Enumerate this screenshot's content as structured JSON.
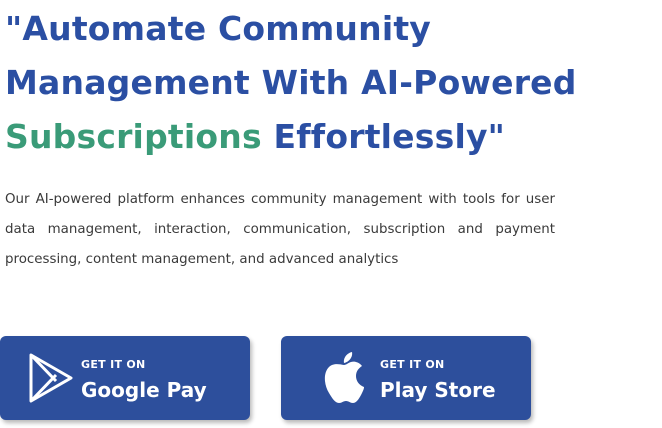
{
  "hero": {
    "title_line1": "\"Automate Community",
    "title_line2": "Management With AI-Powered",
    "title_accent": "Subscriptions",
    "title_end": " Effortlessly\"",
    "description": "Our AI-powered platform enhances community management with tools for user data management, interaction, communication, subscription and payment processing, content management, and advanced analytics"
  },
  "buttons": [
    {
      "eyebrow": "GET IT ON",
      "label": "Google Pay",
      "icon": "play-triangle-icon"
    },
    {
      "eyebrow": "GET IT ON",
      "label": "Play Store",
      "icon": "apple-icon"
    }
  ],
  "colors": {
    "title_blue": "#2b4fa3",
    "title_green": "#3a9b78",
    "button_bg": "#2d4f9c",
    "text": "#3a3a3a"
  }
}
